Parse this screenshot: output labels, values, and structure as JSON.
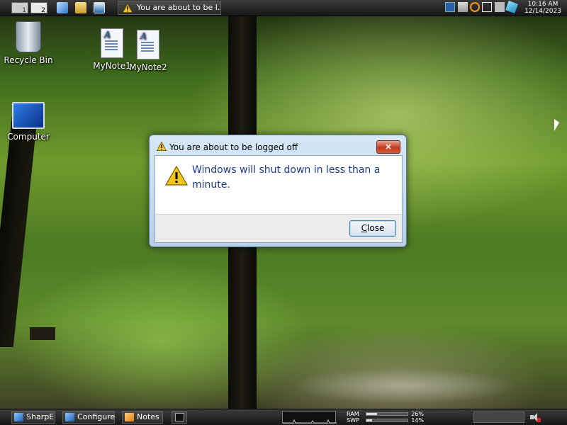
{
  "top_taskbar": {
    "workspaces": [
      "1",
      "2"
    ],
    "task_title": "You are about to be l...",
    "clock": {
      "time": "10:16 AM",
      "date": "12/14/2023"
    }
  },
  "desktop_icons": [
    {
      "label": "Recycle Bin",
      "icon": "recycle-bin-icon"
    },
    {
      "label": "MyNote1",
      "icon": "document-icon"
    },
    {
      "label": "MyNote2",
      "icon": "document-icon"
    },
    {
      "label": "Computer",
      "icon": "computer-icon"
    }
  ],
  "dialog": {
    "title": "You are about to be logged off",
    "message": "Windows will shut down in less than a minute.",
    "close_button_label": "Close",
    "close_button_accel": "C",
    "close_button_rest": "lose"
  },
  "bottom_taskbar": {
    "buttons": [
      "SharpE",
      "Configure",
      "Notes"
    ],
    "memory": [
      {
        "label": "RAM",
        "value": "26%",
        "fraction": 0.26
      },
      {
        "label": "SWP",
        "value": "14%",
        "fraction": 0.14
      }
    ]
  },
  "colors": {
    "dialog_message": "#1a3a8a",
    "close_x_button": "#c23b1e"
  }
}
